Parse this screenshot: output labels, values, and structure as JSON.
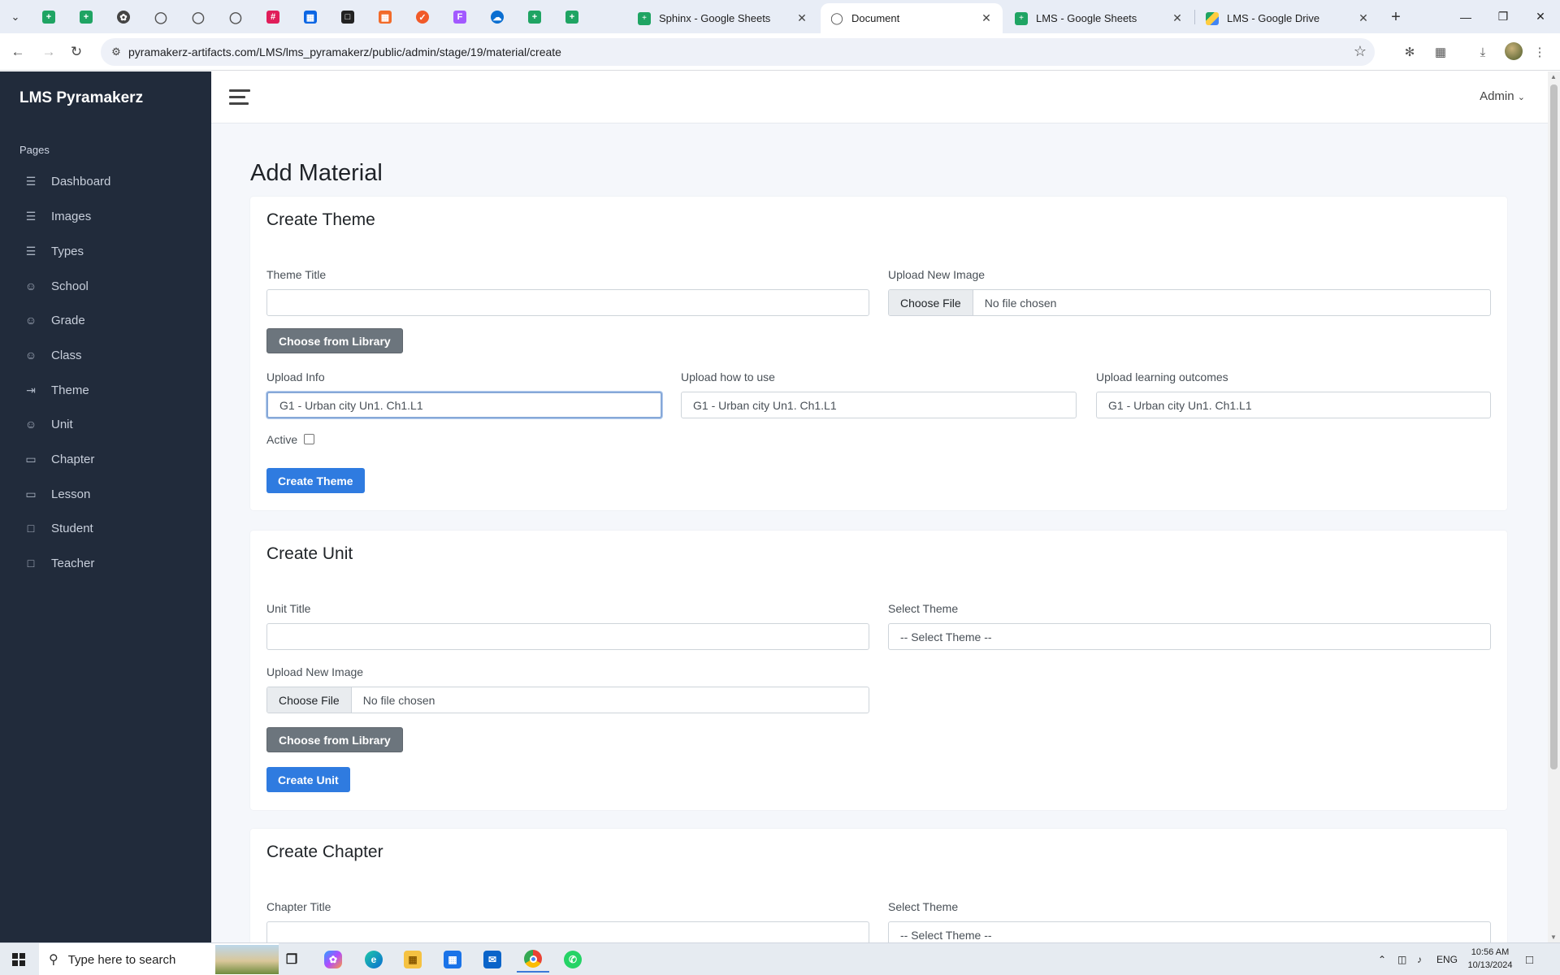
{
  "browser": {
    "tabs": [
      {
        "title": "Sphinx - Google Sheets",
        "icon": "sheets-icon"
      },
      {
        "title": "Document",
        "icon": "globe-icon",
        "active": true
      },
      {
        "title": "LMS - Google Sheets",
        "icon": "sheets-icon"
      },
      {
        "title": "LMS - Google Drive",
        "icon": "drive-icon"
      }
    ],
    "url": "pyramakerz-artifacts.com/LMS/lms_pyramakerz/public/admin/stage/19/material/create"
  },
  "sidebar": {
    "brand": "LMS Pyramakerz",
    "section": "Pages",
    "items": [
      {
        "label": "Dashboard",
        "icon": "sliders-icon"
      },
      {
        "label": "Images",
        "icon": "sliders-icon"
      },
      {
        "label": "Types",
        "icon": "sliders-icon"
      },
      {
        "label": "School",
        "icon": "user-icon"
      },
      {
        "label": "Grade",
        "icon": "user-icon"
      },
      {
        "label": "Class",
        "icon": "user-icon"
      },
      {
        "label": "Theme",
        "icon": "login-icon"
      },
      {
        "label": "Unit",
        "icon": "user-plus-icon"
      },
      {
        "label": "Chapter",
        "icon": "book-icon"
      },
      {
        "label": "Lesson",
        "icon": "book-icon"
      },
      {
        "label": "Student",
        "icon": "square-icon"
      },
      {
        "label": "Teacher",
        "icon": "square-icon"
      }
    ]
  },
  "appbar": {
    "user": "Admin"
  },
  "page": {
    "title": "Add Material"
  },
  "theme_card": {
    "title": "Create Theme",
    "theme_title_label": "Theme Title",
    "theme_title_value": "",
    "upload_image_label": "Upload New Image",
    "choose_file": "Choose File",
    "no_file": "No file chosen",
    "library_button": "Choose from Library",
    "upload_info_label": "Upload Info",
    "upload_info_value": "G1 - Urban city Un1. Ch1.L1",
    "how_to_use_label": "Upload how to use",
    "how_to_use_value": "G1 - Urban city Un1. Ch1.L1",
    "outcomes_label": "Upload learning outcomes",
    "outcomes_value": "G1 - Urban city Un1. Ch1.L1",
    "active_label": "Active",
    "active_checked": false,
    "submit": "Create Theme"
  },
  "unit_card": {
    "title": "Create Unit",
    "unit_title_label": "Unit Title",
    "unit_title_value": "",
    "select_theme_label": "Select Theme",
    "select_theme_value": "-- Select Theme --",
    "upload_image_label": "Upload New Image",
    "choose_file": "Choose File",
    "no_file": "No file chosen",
    "library_button": "Choose from Library",
    "submit": "Create Unit"
  },
  "chapter_card": {
    "title": "Create Chapter",
    "chapter_title_label": "Chapter Title",
    "select_theme_label": "Select Theme",
    "select_theme_value": "-- Select Theme --"
  },
  "taskbar": {
    "search_placeholder": "Type here to search",
    "language": "ENG",
    "time": "10:56 AM",
    "date": "10/13/2024"
  },
  "colors": {
    "sidebar_bg": "#212b3b",
    "primary_button": "#2f7be0",
    "secondary_button": "#6c757d",
    "content_bg": "#f5f7fb"
  }
}
